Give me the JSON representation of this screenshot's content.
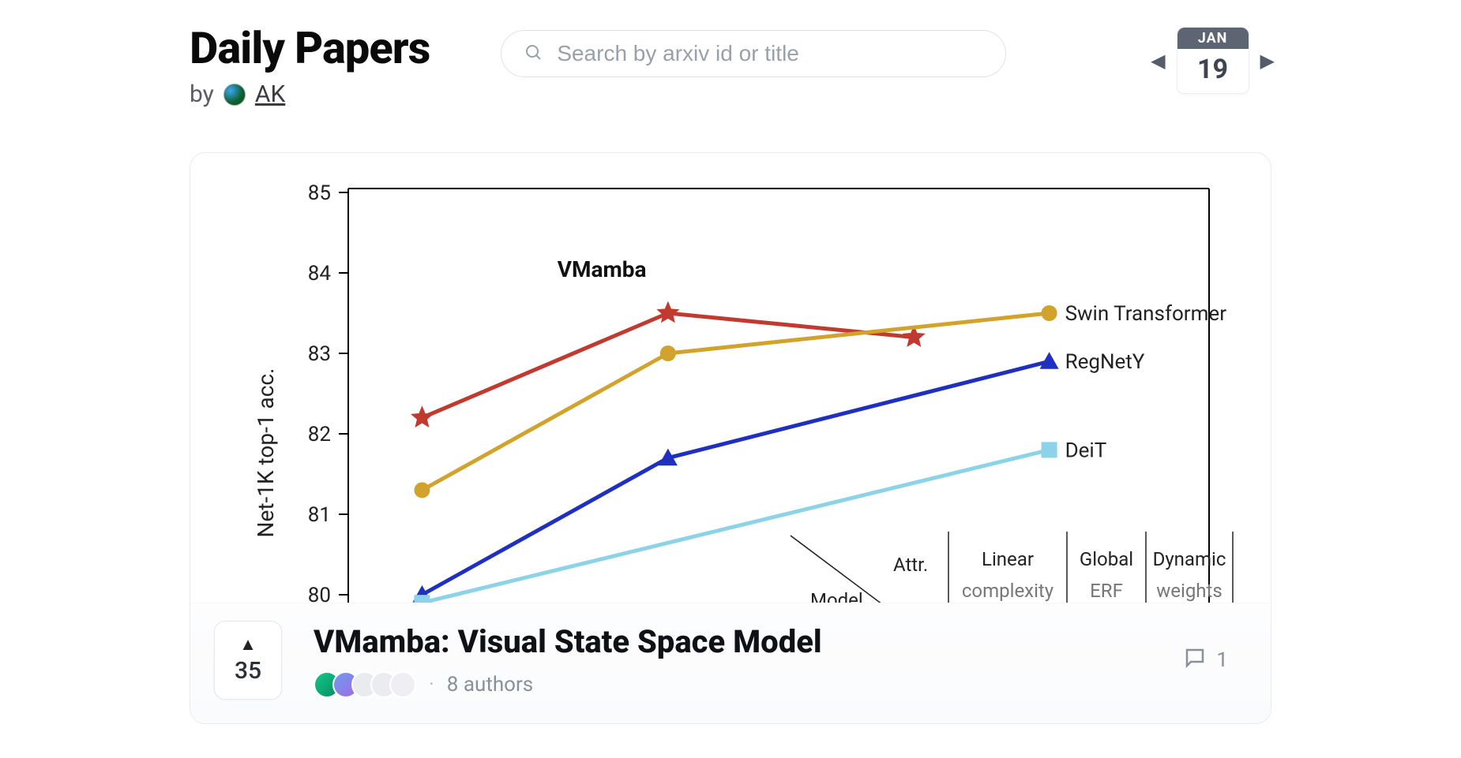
{
  "header": {
    "title": "Daily Papers",
    "byline_prefix": "by",
    "curator_name": "AK"
  },
  "search": {
    "placeholder": "Search by arxiv id or title"
  },
  "date": {
    "month": "JAN",
    "day": "19"
  },
  "paper": {
    "title": "VMamba: Visual State Space Model",
    "upvotes": "35",
    "authors_text": "8 authors",
    "comments": "1"
  },
  "chart_data": {
    "type": "line",
    "title": "",
    "xlabel": "",
    "ylabel": "Net-1K top-1 acc.",
    "ylim": [
      80,
      85
    ],
    "y_ticks": [
      80,
      81,
      82,
      83,
      84,
      85
    ],
    "series": [
      {
        "name": "VMamba",
        "color": "#c03a2f",
        "marker": "star",
        "x": [
          0,
          1,
          2
        ],
        "values": [
          82.2,
          83.5,
          83.2
        ]
      },
      {
        "name": "Swin Transformer",
        "color": "#d2a32c",
        "marker": "circle",
        "x": [
          0,
          1,
          2.55
        ],
        "values": [
          81.3,
          83.0,
          83.5
        ]
      },
      {
        "name": "RegNetY",
        "color": "#1f2fbf",
        "marker": "triangle",
        "x": [
          0,
          1,
          2.55
        ],
        "values": [
          80.0,
          81.7,
          82.9
        ]
      },
      {
        "name": "DeiT",
        "color": "#8cd3e8",
        "marker": "square",
        "x": [
          0,
          2.55
        ],
        "values": [
          79.9,
          81.8
        ]
      }
    ],
    "inset_table": {
      "headers": [
        "Model",
        "Attr.",
        "Linear complexity",
        "Global ERF",
        "Dynamic weights"
      ]
    }
  }
}
